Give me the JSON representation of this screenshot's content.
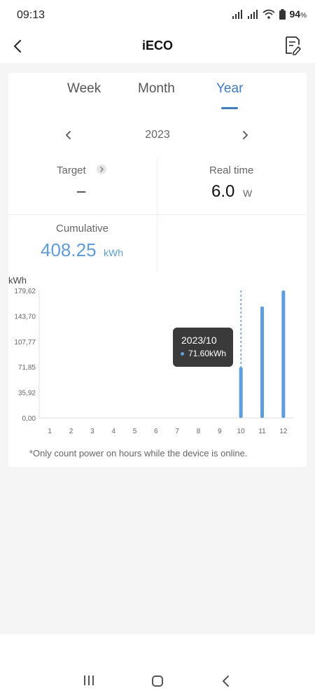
{
  "status": {
    "time": "09:13",
    "battery": "94",
    "battery_unit": "%"
  },
  "header": {
    "title": "iECO",
    "back_icon": "chevron-left-icon",
    "report_icon": "report-edit-icon"
  },
  "tabs": [
    {
      "label": "Week"
    },
    {
      "label": "Month"
    },
    {
      "label": "Year",
      "active": true
    }
  ],
  "colors": {
    "accent": "#3a7bd5",
    "bar": "#5b9de6",
    "tooltip_bg": "#3a3a3a"
  },
  "period": {
    "year": "2023"
  },
  "stats": {
    "target_label": "Target",
    "target_value": "–",
    "realtime_label": "Real time",
    "realtime_value": "6.0",
    "realtime_unit": "W",
    "cumulative_label": "Cumulative",
    "cumulative_value": "408.25",
    "cumulative_unit": "kWh"
  },
  "chart_data": {
    "type": "bar",
    "ylabel": "kWh",
    "categories": [
      "1",
      "2",
      "3",
      "4",
      "5",
      "6",
      "7",
      "8",
      "9",
      "10",
      "11",
      "12"
    ],
    "values": [
      0,
      0,
      0,
      0,
      0,
      0,
      0,
      0,
      0,
      71.6,
      157.0,
      179.62
    ],
    "yticks": [
      "0,00",
      "35,92",
      "71,85",
      "107,77",
      "143,70",
      "179,62"
    ],
    "ylim": [
      0,
      179.62
    ],
    "selected_index": 9
  },
  "tooltip": {
    "date": "2023/10",
    "value": "71.60kWh"
  },
  "footnote": "*Only count power on hours while the device is online.",
  "navbar": {
    "recent_icon": "recent-apps-icon",
    "home_icon": "home-icon",
    "back_icon": "back-icon"
  }
}
